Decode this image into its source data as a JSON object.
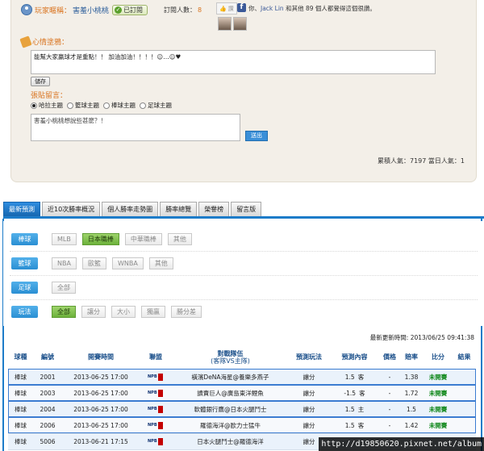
{
  "profile": {
    "player_label": "玩家暱稱：",
    "nickname": "害羞小桃桃",
    "subscribed_label": "已訂閱",
    "subscribers_label": "訂閱人數：",
    "subscribers_count": "8"
  },
  "facebook": {
    "like_label": "讚",
    "text_prefix": "你、",
    "friend_name": "Jack Lin",
    "text_suffix": "和其他 89 個人都覺得這個很讚。"
  },
  "mood": {
    "title": "心情塗鴉：",
    "text": "能幫大家贏球才是重點！！ 加油加油！！！！☺…☺♥",
    "save_label": "儲存"
  },
  "guestbook": {
    "title": "張貼留言：",
    "options": [
      "哈拉主題",
      "籃球主題",
      "棒球主題",
      "足球主題"
    ],
    "selected_index": 0,
    "message": "害羞小桃桃想說些甚麼？！",
    "send_label": "送出"
  },
  "popularity": {
    "text": "累積人氣：7197  當日人氣：1"
  },
  "tabs": [
    {
      "label": "最新預測",
      "active": true
    },
    {
      "label": "近10次勝率概況",
      "active": false
    },
    {
      "label": "個人勝率走勢圖",
      "active": false
    },
    {
      "label": "勝率總覽",
      "active": false
    },
    {
      "label": "榮譽榜",
      "active": false
    },
    {
      "label": "留言版",
      "active": false
    }
  ],
  "filters": {
    "baseball": {
      "label": "棒球",
      "options": [
        "MLB",
        "日本職棒",
        "中華職棒",
        "其他"
      ]
    },
    "basketball": {
      "label": "籃球",
      "options": [
        "NBA",
        "歐籃",
        "WNBA",
        "其他"
      ]
    },
    "soccer": {
      "label": "足球",
      "options": [
        "全部"
      ]
    },
    "playtype": {
      "label": "玩法",
      "options": [
        "全部",
        "讓分",
        "大小",
        "獨贏",
        "勝分差"
      ]
    }
  },
  "updated": "最新更新時間: 2013/06/25 09:41:38",
  "table": {
    "headers": {
      "sport": "球種",
      "id": "編號",
      "time": "開賽時間",
      "league": "聯盟",
      "teams": "對戰隊伍",
      "teams_sub": "(客隊VS主隊)",
      "play": "預測玩法",
      "content": "預測內容",
      "price": "價格",
      "rate": "賠率",
      "score": "比分",
      "result": "結果"
    },
    "rows": [
      {
        "sport": "棒球",
        "id": "2001",
        "time": "2013-06-25 17:00",
        "league": "NPB",
        "teams": "橫濱DeNA海星@養樂多燕子",
        "play": "讓分",
        "line": "1.5",
        "pick": "客",
        "price": "-",
        "rate": "1.38",
        "score": "未開賽",
        "result": ""
      },
      {
        "sport": "棒球",
        "id": "2003",
        "time": "2013-06-25 17:00",
        "league": "NPB",
        "teams": "讀賣巨人@廣島東洋鯉魚",
        "play": "讓分",
        "line": "-1.5",
        "pick": "客",
        "price": "-",
        "rate": "1.72",
        "score": "未開賽",
        "result": ""
      },
      {
        "sport": "棒球",
        "id": "2004",
        "time": "2013-06-25 17:00",
        "league": "NPB",
        "teams": "軟體銀行鷹@日本火腿鬥士",
        "play": "讓分",
        "line": "1.5",
        "pick": "主",
        "price": "-",
        "rate": "1.5",
        "score": "未開賽",
        "result": ""
      },
      {
        "sport": "棒球",
        "id": "2006",
        "time": "2013-06-25 17:00",
        "league": "NPB",
        "teams": "羅德海洋@歐力士猛牛",
        "play": "讓分",
        "line": "1.5",
        "pick": "客",
        "price": "-",
        "rate": "1.42",
        "score": "未開賽",
        "result": ""
      },
      {
        "sport": "棒球",
        "id": "5006",
        "time": "2013-06-21 17:15",
        "league": "NPB",
        "teams": "日本火腿鬥士@羅德海洋",
        "play": "讓分",
        "line": "",
        "pick": "",
        "price": "",
        "rate": "",
        "score": "",
        "result": ""
      }
    ]
  },
  "watermark": "http://d19850620.pixnet.net/album"
}
